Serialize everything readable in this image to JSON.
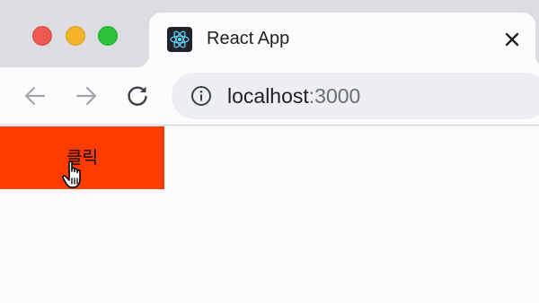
{
  "browser": {
    "tab": {
      "title": "React App",
      "favicon": "react-logo-icon",
      "close_icon": "close-icon"
    },
    "toolbar": {
      "back_icon": "arrow-left-icon",
      "forward_icon": "arrow-right-icon",
      "reload_icon": "reload-icon",
      "info_icon": "info-icon",
      "url_host": "localhost",
      "url_port": ":3000"
    },
    "colors": {
      "tabstrip": "#dcdde1",
      "page_background": "#fdfbfd",
      "traffic_close": "#ee5a52",
      "traffic_minimize": "#f5b328",
      "traffic_maximize": "#2dc13e"
    }
  },
  "page": {
    "button_label": "클릭",
    "button_color": "#ff3c00",
    "cursor": "pointer-hand-icon"
  }
}
